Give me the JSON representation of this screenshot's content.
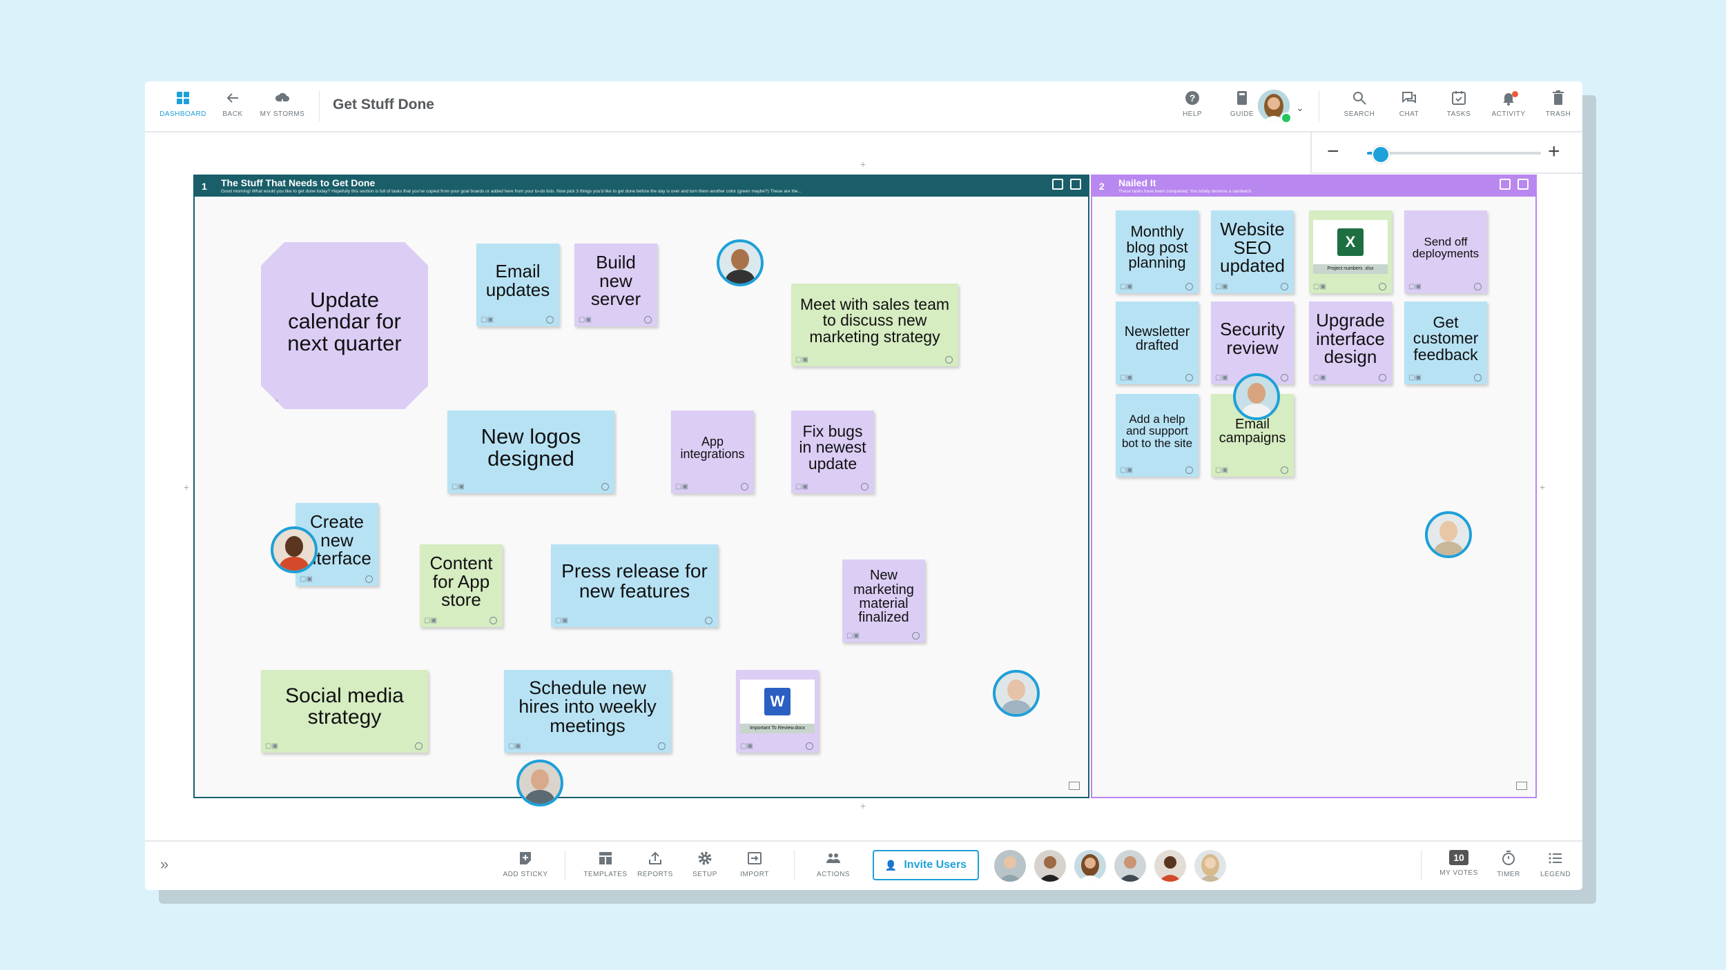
{
  "board_title": "Get Stuff Done",
  "topbar": {
    "nav": [
      {
        "label": "DASHBOARD",
        "icon": "dashboard-icon"
      },
      {
        "label": "BACK",
        "icon": "arrow-left-icon"
      },
      {
        "label": "MY STORMS",
        "icon": "cloud-icon"
      }
    ],
    "right": [
      {
        "label": "HELP",
        "icon": "help-icon"
      },
      {
        "label": "GUIDE",
        "icon": "book-icon"
      },
      {
        "label": "SEARCH",
        "icon": "search-icon"
      },
      {
        "label": "CHAT",
        "icon": "chat-icon"
      },
      {
        "label": "TASKS",
        "icon": "tasks-icon"
      },
      {
        "label": "ACTIVITY",
        "icon": "bell-icon"
      },
      {
        "label": "TRASH",
        "icon": "trash-icon"
      }
    ]
  },
  "zoom": {
    "minus": "−",
    "plus": "+",
    "level": 0.07
  },
  "sections": [
    {
      "number": "1",
      "title": "The Stuff That Needs to Get Done",
      "description": "Good morning! What would you like to get done today? Hopefully this section is full of tasks that you've copied from your goal boards or added here from your to-do lists. Now pick 3 things you'd like to get done before the day is over and turn them another color (green maybe?) These are the..."
    },
    {
      "number": "2",
      "title": "Nailed It",
      "description": "These tasks have been conquered. You totally deserve a sandwich."
    }
  ],
  "stickies": {
    "update_calendar": "Update calendar for next quarter",
    "email_updates": "Email updates",
    "build_server": "Build new server",
    "meet_sales": "Meet with sales team to discuss new marketing strategy",
    "new_logos": "New logos designed",
    "app_integrations": "App integrations",
    "fix_bugs": "Fix bugs in newest update",
    "create_interface": "Create new interface",
    "content_app_store": "Content for App store",
    "press_release": "Press release for new features",
    "new_marketing": "New marketing material finalized",
    "social_media": "Social media strategy",
    "schedule_meetings": "Schedule new hires into weekly meetings",
    "word_file": "Important To Review.docx",
    "monthly_blog": "Monthly blog post planning",
    "website_seo": "Website SEO updated",
    "excel_file": "Project numbers .xlsx",
    "send_off": "Send off deployments",
    "newsletter": "Newsletter drafted",
    "security_review": "Security review",
    "upgrade_interface": "Upgrade interface design",
    "customer_feedback": "Get customer feedback",
    "help_bot": "Add a help and support bot to the site",
    "email_campaigns": "Email campaigns"
  },
  "file_icons": {
    "excel": "X",
    "word": "W"
  },
  "bottombar": {
    "expand": "»",
    "add_sticky": "ADD STICKY",
    "templates": "TEMPLATES",
    "reports": "REPORTS",
    "setup": "SETUP",
    "import": "IMPORT",
    "actions": "ACTIONS",
    "invite": "Invite Users",
    "my_votes_count": "10",
    "my_votes": "MY VOTES",
    "timer": "TIMER",
    "legend": "LEGEND"
  },
  "colors": {
    "accent": "#1ea0d8",
    "section1": "#195e68",
    "section2": "#b887f0",
    "sticky_blue": "#b7e2f4",
    "sticky_purple": "#dccdf5",
    "sticky_green": "#d6ecc1"
  }
}
